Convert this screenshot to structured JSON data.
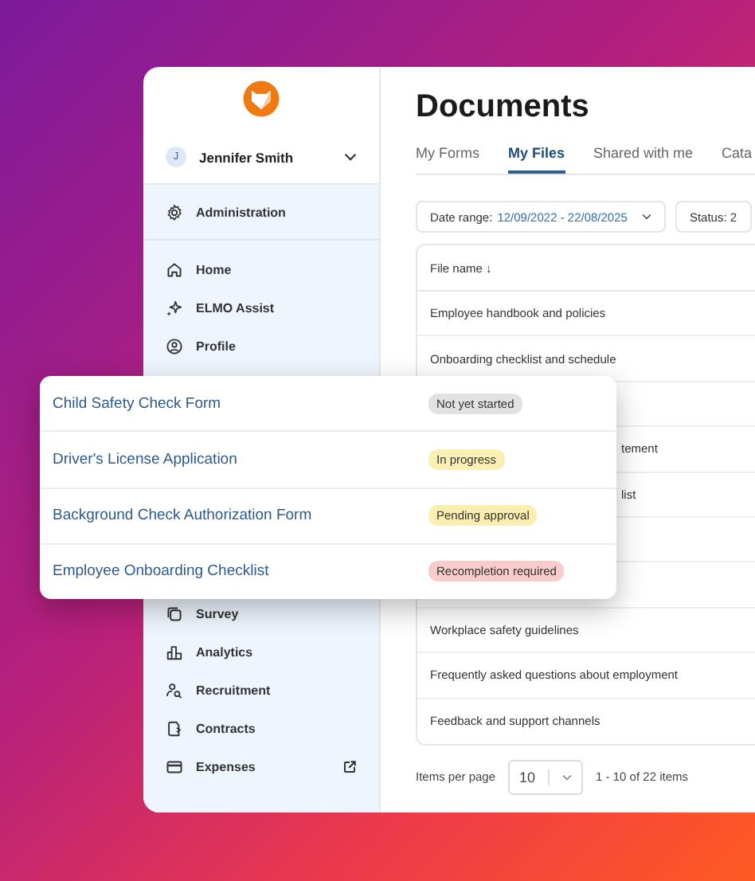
{
  "sidebar": {
    "user": {
      "initial": "J",
      "name": "Jennifer Smith"
    },
    "admin": {
      "label": "Administration"
    },
    "items": [
      {
        "kind": "item",
        "label": "Home"
      },
      {
        "kind": "item",
        "label": "ELMO Assist"
      },
      {
        "kind": "item",
        "label": "Profile"
      },
      {
        "kind": "covered"
      },
      {
        "kind": "covered"
      },
      {
        "kind": "covered"
      },
      {
        "kind": "covered"
      },
      {
        "kind": "covered"
      },
      {
        "kind": "covered"
      },
      {
        "kind": "item",
        "label": "Survey"
      },
      {
        "kind": "item",
        "label": "Analytics"
      },
      {
        "kind": "item",
        "label": "Recruitment"
      },
      {
        "kind": "item",
        "label": "Contracts"
      },
      {
        "kind": "item",
        "label": "Expenses",
        "external": true
      }
    ]
  },
  "page": {
    "title": "Documents",
    "tabs": [
      {
        "label": "My Forms",
        "selected": false
      },
      {
        "label": "My Files",
        "selected": true
      },
      {
        "label": "Shared with me",
        "selected": false
      },
      {
        "label": "Cata",
        "selected": false
      }
    ],
    "filters": {
      "date_label": "Date range:",
      "date_value": "12/09/2022 - 22/08/2025",
      "status": "Status: 2"
    },
    "table": {
      "column": "File name",
      "sort_indicator": "↓",
      "rows": [
        {
          "kind": "full",
          "file_name": "Employee handbook and policies"
        },
        {
          "kind": "full",
          "file_name": "Onboarding checklist and schedule"
        },
        {
          "kind": "covered"
        },
        {
          "kind": "cut",
          "file_name": "tement"
        },
        {
          "kind": "cut",
          "file_name": "list"
        },
        {
          "kind": "covered"
        },
        {
          "kind": "covered"
        },
        {
          "kind": "full",
          "file_name": "Workplace safety guidelines"
        },
        {
          "kind": "full",
          "file_name": "Frequently asked questions about employment"
        },
        {
          "kind": "full",
          "file_name": "Feedback and support channels"
        }
      ]
    },
    "pagination": {
      "label": "Items per page",
      "per_page": "10",
      "range": "1 - 10 of 22 items"
    }
  },
  "forms_popup": [
    {
      "name": "Child Safety Check Form",
      "status": "Not yet started",
      "color": "#e2e2e2"
    },
    {
      "name": "Driver's License Application",
      "status": "In progress",
      "color": "#fbf0b4"
    },
    {
      "name": "Background Check Authorization Form",
      "status": "Pending approval",
      "color": "#fbeeb0"
    },
    {
      "name": "Employee Onboarding Checklist",
      "status": "Recompletion required",
      "color": "#f8cccc"
    }
  ]
}
